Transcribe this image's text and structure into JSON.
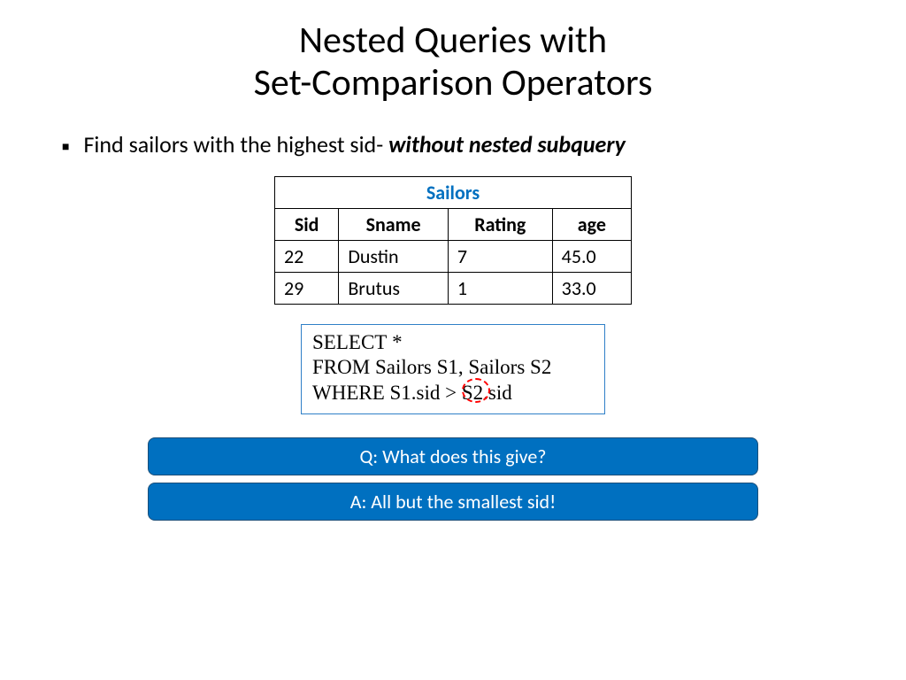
{
  "title_line1": "Nested Queries with",
  "title_line2": "Set-Comparison Operators",
  "bullet": {
    "prefix": "Find sailors with the highest sid- ",
    "emph": "without nested subquery"
  },
  "table": {
    "caption": "Sailors",
    "headers": [
      "Sid",
      "Sname",
      "Rating",
      "age"
    ],
    "rows": [
      [
        "22",
        "Dustin",
        "7",
        "45.0"
      ],
      [
        "29",
        "Brutus",
        "1",
        "33.0"
      ]
    ]
  },
  "sql": {
    "select": "SELECT",
    "select_rest": "  *",
    "from": "FROM",
    "from_rest": "  Sailors S1, Sailors S2",
    "where": "WHERE",
    "where_rest": "  S1.sid > S2.sid"
  },
  "banners": {
    "q": "Q: What does this give?",
    "a": "A: All but the smallest sid!"
  }
}
